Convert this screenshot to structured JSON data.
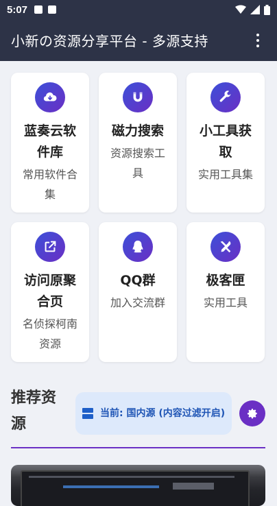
{
  "status_bar": {
    "time": "5:07",
    "icons": [
      "image-icon",
      "a-icon",
      "wifi-icon",
      "signal-icon",
      "battery-icon"
    ]
  },
  "app_bar": {
    "title": "小新の资源分享平台 - 多源支持",
    "menu_icon": "more-vert-icon"
  },
  "cards": [
    {
      "title": "蓝奏云软件库",
      "desc": "常用软件合集",
      "icon": "cloud-download-icon"
    },
    {
      "title": "磁力搜索",
      "desc": "资源搜索工具",
      "icon": "magnet-icon"
    },
    {
      "title": "小工具获取",
      "desc": "实用工具集",
      "icon": "wrench-icon"
    },
    {
      "title": "访问原聚合页",
      "desc": "名侦探柯南资源",
      "icon": "external-link-icon"
    },
    {
      "title": "QQ群",
      "desc": "加入交流群",
      "icon": "qq-icon"
    },
    {
      "title": "极客匣",
      "desc": "实用工具",
      "icon": "tools-icon"
    }
  ],
  "recommend": {
    "title": "推荐资源",
    "source_label": "当前: 国内源 (内容过滤开启)",
    "source_icon": "server-icon",
    "settings_icon": "gear-icon"
  },
  "colors": {
    "appbar": "#2d3347",
    "accent": "#6a2fc4",
    "pill_bg": "#dde9fb",
    "pill_text": "#1f55b5"
  }
}
